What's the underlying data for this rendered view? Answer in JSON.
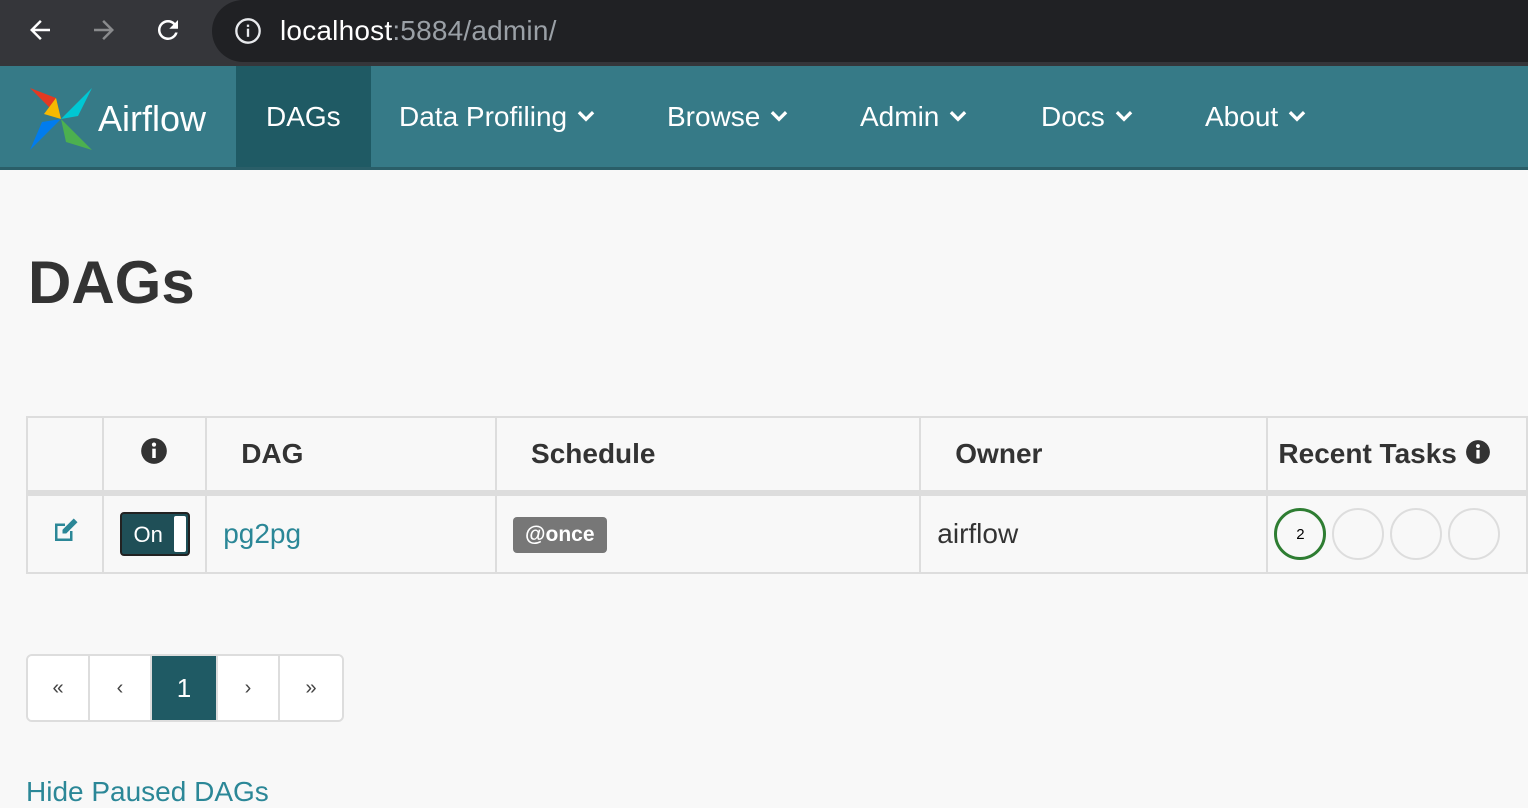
{
  "browser": {
    "url_host": "localhost",
    "url_rest": ":5884/admin/"
  },
  "navbar": {
    "brand": "Airflow",
    "items": [
      {
        "label": "DAGs",
        "active": true
      },
      {
        "label": "Data Profiling"
      },
      {
        "label": "Browse"
      },
      {
        "label": "Admin"
      },
      {
        "label": "Docs"
      },
      {
        "label": "About"
      }
    ]
  },
  "page": {
    "title": "DAGs"
  },
  "table": {
    "headers": {
      "dag": "DAG",
      "schedule": "Schedule",
      "owner": "Owner",
      "recent_tasks": "Recent Tasks"
    },
    "rows": [
      {
        "toggle": "On",
        "dag": "pg2pg",
        "schedule": "@once",
        "owner": "airflow",
        "recent_tasks_count": "2"
      }
    ]
  },
  "pagination": {
    "first": "«",
    "prev": "‹",
    "current": "1",
    "next": "›",
    "last": "»"
  },
  "hide_paused": "Hide Paused DAGs",
  "colors": {
    "navbar": "#367a87",
    "active_nav": "#1f5a64",
    "link": "#2b8797",
    "success": "#2e7d32"
  }
}
